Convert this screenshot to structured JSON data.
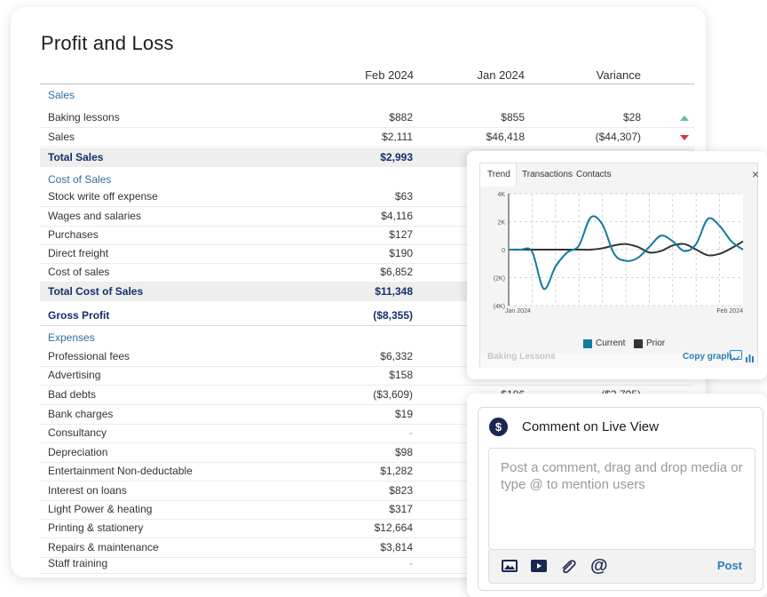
{
  "report": {
    "title": "Profit and Loss",
    "columns": [
      "Feb 2024",
      "Jan 2024",
      "Variance"
    ]
  },
  "rows": [
    {
      "type": "section",
      "label": "Sales"
    },
    {
      "type": "item",
      "label": "Baking lessons",
      "feb": "$882",
      "jan": "$855",
      "var": "$28",
      "trend": "up"
    },
    {
      "type": "item",
      "label": "Sales",
      "feb": "$2,111",
      "jan": "$46,418",
      "var": "($44,307)",
      "trend": "down"
    },
    {
      "type": "total",
      "label": "Total Sales",
      "feb": "$2,993"
    },
    {
      "type": "section",
      "label": "Cost of Sales"
    },
    {
      "type": "item",
      "label": "Stock write off expense",
      "feb": "$63"
    },
    {
      "type": "item",
      "label": "Wages and salaries",
      "feb": "$4,116"
    },
    {
      "type": "item",
      "label": "Purchases",
      "feb": "$127"
    },
    {
      "type": "item",
      "label": "Direct freight",
      "feb": "$190"
    },
    {
      "type": "item",
      "label": "Cost of sales",
      "feb": "$6,852"
    },
    {
      "type": "total",
      "label": "Total Cost of Sales",
      "feb": "$11,348"
    },
    {
      "type": "gross",
      "label": "Gross Profit",
      "feb": "($8,355)"
    },
    {
      "type": "section",
      "label": "Expenses"
    },
    {
      "type": "item",
      "label": "Professional fees",
      "feb": "$6,332"
    },
    {
      "type": "item",
      "label": "Advertising",
      "feb": "$158"
    },
    {
      "type": "item",
      "label": "Bad debts",
      "feb": "($3,609)",
      "jan": "$186",
      "var": "($3,795)"
    },
    {
      "type": "item",
      "label": "Bank charges",
      "feb": "$19"
    },
    {
      "type": "item",
      "label": "Consultancy",
      "feb": "-"
    },
    {
      "type": "item",
      "label": "Depreciation",
      "feb": "$98"
    },
    {
      "type": "item",
      "label": "Entertainment Non-deductable",
      "feb": "$1,282"
    },
    {
      "type": "item",
      "label": "Interest on loans",
      "feb": "$823"
    },
    {
      "type": "item",
      "label": "Light Power & heating",
      "feb": "$317"
    },
    {
      "type": "item",
      "label": "Printing & stationery",
      "feb": "$12,664"
    },
    {
      "type": "item",
      "label": "Repairs & maintenance",
      "feb": "$3,814"
    },
    {
      "type": "item",
      "label": "Staff training",
      "feb": "-"
    }
  ],
  "trend_panel": {
    "tabs": [
      "Trend",
      "Transactions",
      "Contacts"
    ],
    "close": "×",
    "footer_label": "Baking Lessons",
    "copy_graph": "Copy graph",
    "chart_data": {
      "type": "line",
      "y_tick_labels": [
        "4K",
        "2K",
        "0",
        "(2K)",
        "(4K)"
      ],
      "y_ticks": [
        4000,
        2000,
        0,
        -2000,
        -4000
      ],
      "ylim": [
        -4000,
        4000
      ],
      "x_start_label": "Jan 2024",
      "x_end_label": "Feb 2024",
      "x": [
        0,
        1,
        2,
        3,
        4,
        5,
        6,
        7,
        8,
        9,
        10,
        11,
        12,
        13,
        14,
        15,
        16,
        17,
        18,
        19,
        20
      ],
      "series": [
        {
          "name": "Current",
          "color": "#137aa0",
          "values": [
            0,
            0,
            -150,
            -2800,
            -1200,
            -200,
            300,
            2300,
            1800,
            -300,
            -800,
            -600,
            200,
            1000,
            600,
            -100,
            400,
            2200,
            1700,
            600,
            0
          ]
        },
        {
          "name": "Prior",
          "color": "#333333",
          "values": [
            0,
            0,
            0,
            0,
            0,
            0,
            0,
            0,
            100,
            300,
            400,
            200,
            -200,
            -100,
            300,
            400,
            0,
            -400,
            -300,
            100,
            600
          ]
        }
      ],
      "grid": true
    }
  },
  "comment_panel": {
    "icon_glyph": "$",
    "title": "Comment on Live View",
    "placeholder": "Post a comment, drag and drop media or type @ to mention users",
    "post_label": "Post"
  }
}
